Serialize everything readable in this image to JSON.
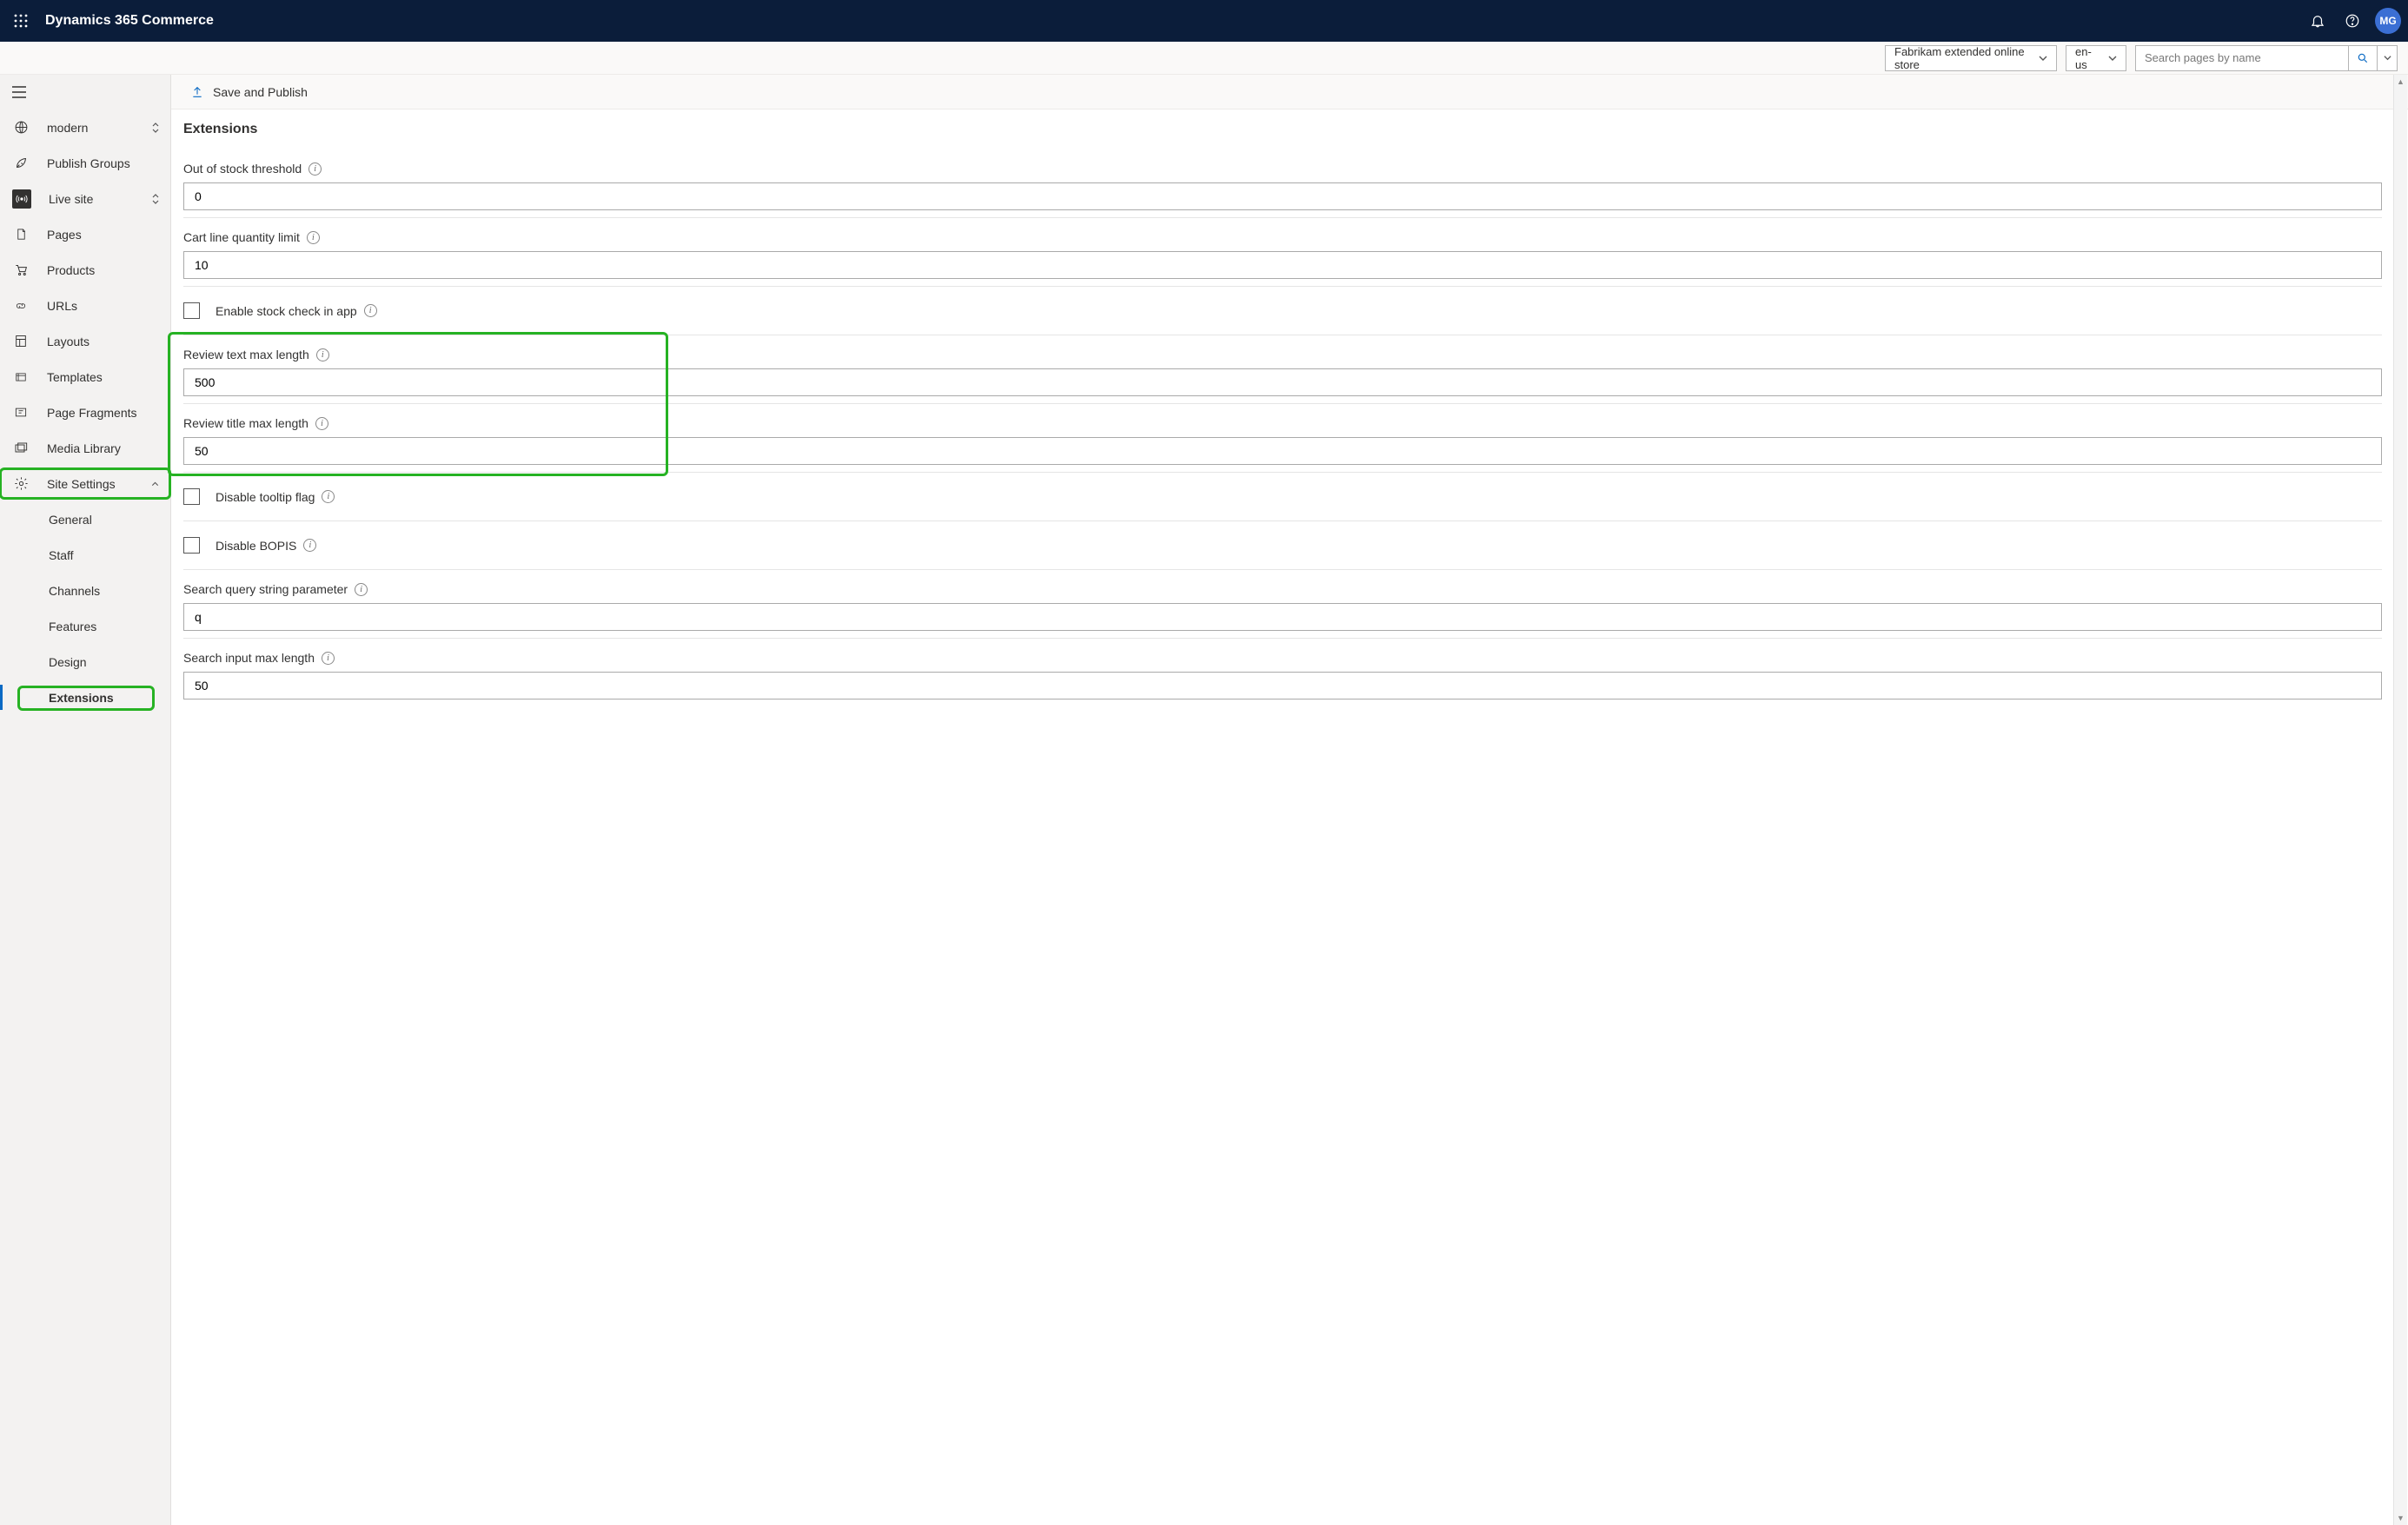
{
  "header": {
    "brand": "Dynamics 365 Commerce",
    "avatar_initials": "MG"
  },
  "subheader": {
    "store": "Fabrikam extended online store",
    "language": "en-us",
    "search_placeholder": "Search pages by name"
  },
  "commandbar": {
    "save_publish": "Save and Publish"
  },
  "sidebar": {
    "site_switcher": "modern",
    "items": [
      {
        "label": "Publish Groups"
      },
      {
        "label": "Live site"
      },
      {
        "label": "Pages"
      },
      {
        "label": "Products"
      },
      {
        "label": "URLs"
      },
      {
        "label": "Layouts"
      },
      {
        "label": "Templates"
      },
      {
        "label": "Page Fragments"
      },
      {
        "label": "Media Library"
      },
      {
        "label": "Site Settings"
      }
    ],
    "settings_children": [
      {
        "label": "General"
      },
      {
        "label": "Staff"
      },
      {
        "label": "Channels"
      },
      {
        "label": "Features"
      },
      {
        "label": "Design"
      },
      {
        "label": "Extensions"
      }
    ]
  },
  "page": {
    "title": "Extensions",
    "fields": {
      "out_of_stock_threshold": {
        "label": "Out of stock threshold",
        "value": "0"
      },
      "cart_line_quantity_limit": {
        "label": "Cart line quantity limit",
        "value": "10"
      },
      "enable_stock_check": {
        "label": "Enable stock check in app",
        "checked": false
      },
      "review_text_max_length": {
        "label": "Review text max length",
        "value": "500"
      },
      "review_title_max_length": {
        "label": "Review title max length",
        "value": "50"
      },
      "disable_tooltip_flag": {
        "label": "Disable tooltip flag",
        "checked": false
      },
      "disable_bopis": {
        "label": "Disable BOPIS",
        "checked": false
      },
      "search_query_string_parameter": {
        "label": "Search query string parameter",
        "value": "q"
      },
      "search_input_max_length": {
        "label": "Search input max length",
        "value": "50"
      }
    }
  }
}
